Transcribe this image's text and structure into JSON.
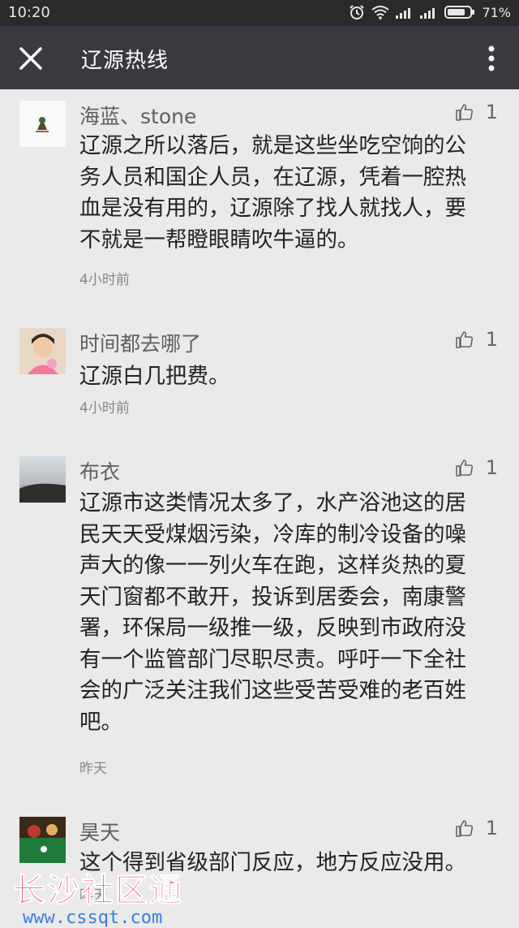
{
  "status_bar": {
    "time": "10:20",
    "battery": "71%"
  },
  "header": {
    "title": "辽源热线"
  },
  "comments": [
    {
      "name": "海蓝、stone",
      "likes": "1",
      "lines": [
        "辽源之所以落后，就是这些坐吃空饷的公",
        "务人员和国企人员，在辽源，凭着一腔热",
        "血是没有用的，辽源除了找人就找人，要",
        "不就是一帮瞪眼睛吹牛逼的。"
      ],
      "time": "4小时前"
    },
    {
      "name": "时间都去哪了",
      "likes": "1",
      "lines": [
        "辽源白几把费。"
      ],
      "time": "4小时前"
    },
    {
      "name": "布衣",
      "likes": "1",
      "lines": [
        "辽源市这类情况太多了，水产浴池这的居",
        "民天天受煤烟污染，冷库的制冷设备的噪",
        "声大的像一一列火车在跑，这样炎热的夏",
        "天门窗都不敢开，投诉到居委会，南康警",
        "署，环保局一级推一级，反映到市政府没",
        "有一个监管部门尽职尽责。呼吁一下全社",
        "会的广泛关注我们这些受苦受难的老百姓",
        "吧。"
      ],
      "time": "昨天"
    },
    {
      "name": "昊天",
      "likes": "1",
      "lines": [
        "这个得到省级部门反应，地方反应没用。"
      ],
      "time": "昨天"
    }
  ],
  "watermark": {
    "title": "长沙社区通",
    "url": "www.cssqt.com"
  },
  "colors": {
    "status_bar": "#2a2a2a",
    "nav_bar": "#393a3f",
    "background": "#eaeaea",
    "watermark": "#f5446e"
  }
}
